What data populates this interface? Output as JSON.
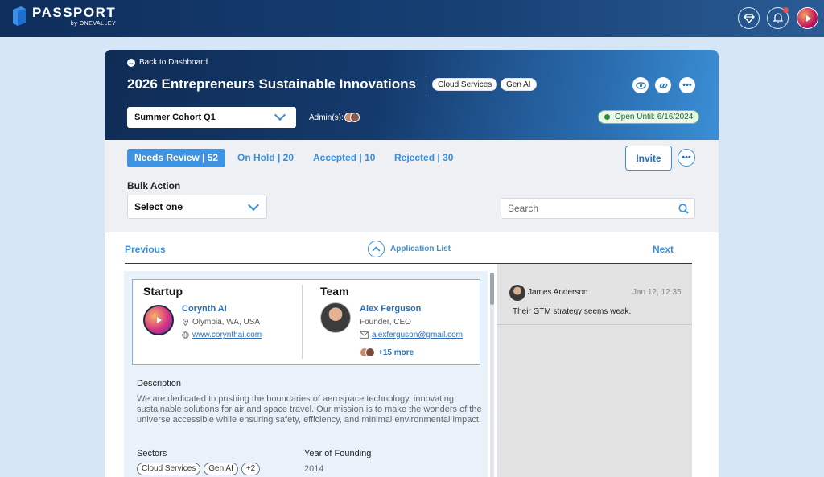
{
  "brand": {
    "name": "PASSPORT",
    "tagline": "by ONEVALLEY"
  },
  "topbar": {
    "icons": [
      "diamond-icon",
      "bell-icon",
      "user-avatar"
    ],
    "notification_dot_color": "#e45050"
  },
  "header": {
    "back_label": "Back to Dashboard",
    "title": "2026 Entrepreneurs Sustainable Innovations",
    "tags": [
      "Cloud Services",
      "Gen AI"
    ],
    "cohort": "Summer Cohort Q1",
    "admins_label": "Admin(s):",
    "status": "Open Until: 6/16/2024"
  },
  "tabs": [
    {
      "label": "Needs Review | 52",
      "active": true
    },
    {
      "label": "On Hold | 20",
      "active": false
    },
    {
      "label": "Accepted | 10",
      "active": false
    },
    {
      "label": "Rejected | 30",
      "active": false
    }
  ],
  "toolbar": {
    "invite_label": "Invite"
  },
  "bulk": {
    "label": "Bulk Action",
    "value": "Select one"
  },
  "search": {
    "placeholder": "Search"
  },
  "nav": {
    "previous": "Previous",
    "list": "Application List",
    "next": "Next"
  },
  "startup": {
    "heading": "Startup",
    "name": "Corynth AI",
    "location": "Olympia, WA, USA",
    "website": "www.corynthai.com"
  },
  "team": {
    "heading": "Team",
    "name": "Alex Ferguson",
    "role": "Founder, CEO",
    "email": "alexferguson@gmail.com",
    "more": "+15 more"
  },
  "details": {
    "description_label": "Description",
    "description": "We are dedicated to pushing the boundaries of aerospace technology, innovating sustainable solutions for air and space travel. Our mission is to make the wonders of the universe accessible while ensuring safety, efficiency, and minimal environmental impact.",
    "sectors_label": "Sectors",
    "sectors": [
      "Cloud Services",
      "Gen AI",
      "+2"
    ],
    "founding_label": "Year of Founding",
    "founding_year": "2014"
  },
  "comments": [
    {
      "author": "James Anderson",
      "time": "Jan 12, 12:35",
      "text": "Their GTM strategy seems weak."
    }
  ],
  "colors": {
    "accent": "#3a8fdc",
    "header_dark": "#0f2c55",
    "open_green": "#2e8b2e"
  }
}
